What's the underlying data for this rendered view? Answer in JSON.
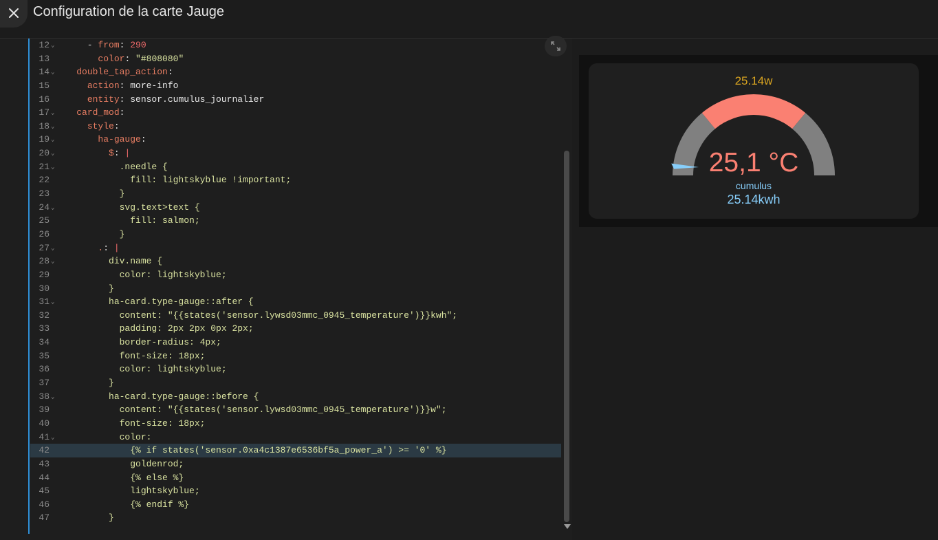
{
  "header": {
    "title": "Configuration de la carte Jauge"
  },
  "editor": {
    "lines": [
      {
        "num": "12",
        "fold": true,
        "segs": [
          {
            "t": "      - ",
            "c": "t"
          },
          {
            "t": "from",
            "c": "k"
          },
          {
            "t": ": ",
            "c": "t"
          },
          {
            "t": "290",
            "c": "n"
          }
        ]
      },
      {
        "num": "13",
        "fold": false,
        "segs": [
          {
            "t": "        ",
            "c": "t"
          },
          {
            "t": "color",
            "c": "k"
          },
          {
            "t": ": ",
            "c": "t"
          },
          {
            "t": "\"#808080\"",
            "c": "s"
          }
        ]
      },
      {
        "num": "14",
        "fold": true,
        "segs": [
          {
            "t": "    ",
            "c": "t"
          },
          {
            "t": "double_tap_action",
            "c": "k"
          },
          {
            "t": ":",
            "c": "t"
          }
        ]
      },
      {
        "num": "15",
        "fold": false,
        "segs": [
          {
            "t": "      ",
            "c": "t"
          },
          {
            "t": "action",
            "c": "k"
          },
          {
            "t": ": more-info",
            "c": "t"
          }
        ]
      },
      {
        "num": "16",
        "fold": false,
        "segs": [
          {
            "t": "      ",
            "c": "t"
          },
          {
            "t": "entity",
            "c": "k"
          },
          {
            "t": ": sensor.cumulus_journalier",
            "c": "t"
          }
        ]
      },
      {
        "num": "17",
        "fold": true,
        "segs": [
          {
            "t": "    ",
            "c": "t"
          },
          {
            "t": "card_mod",
            "c": "k"
          },
          {
            "t": ":",
            "c": "t"
          }
        ]
      },
      {
        "num": "18",
        "fold": true,
        "segs": [
          {
            "t": "      ",
            "c": "t"
          },
          {
            "t": "style",
            "c": "k"
          },
          {
            "t": ":",
            "c": "t"
          }
        ]
      },
      {
        "num": "19",
        "fold": true,
        "segs": [
          {
            "t": "        ",
            "c": "t"
          },
          {
            "t": "ha-gauge",
            "c": "k"
          },
          {
            "t": ":",
            "c": "t"
          }
        ]
      },
      {
        "num": "20",
        "fold": true,
        "segs": [
          {
            "t": "          ",
            "c": "t"
          },
          {
            "t": "$",
            "c": "k"
          },
          {
            "t": ": ",
            "c": "t"
          },
          {
            "t": "|",
            "c": "n"
          }
        ]
      },
      {
        "num": "21",
        "fold": true,
        "segs": [
          {
            "t": "            .needle {",
            "c": "s"
          }
        ]
      },
      {
        "num": "22",
        "fold": false,
        "segs": [
          {
            "t": "              fill: lightskyblue !important;",
            "c": "s"
          }
        ]
      },
      {
        "num": "23",
        "fold": false,
        "segs": [
          {
            "t": "            }",
            "c": "s"
          }
        ]
      },
      {
        "num": "24",
        "fold": true,
        "segs": [
          {
            "t": "            svg.text>text {",
            "c": "s"
          }
        ]
      },
      {
        "num": "25",
        "fold": false,
        "segs": [
          {
            "t": "              fill: salmon;",
            "c": "s"
          }
        ]
      },
      {
        "num": "26",
        "fold": false,
        "segs": [
          {
            "t": "            }",
            "c": "s"
          }
        ]
      },
      {
        "num": "27",
        "fold": true,
        "segs": [
          {
            "t": "        ",
            "c": "t"
          },
          {
            "t": ".",
            "c": "k"
          },
          {
            "t": ": ",
            "c": "t"
          },
          {
            "t": "|",
            "c": "n"
          }
        ]
      },
      {
        "num": "28",
        "fold": true,
        "segs": [
          {
            "t": "          div.name {",
            "c": "s"
          }
        ]
      },
      {
        "num": "29",
        "fold": false,
        "segs": [
          {
            "t": "            color: lightskyblue;",
            "c": "s"
          }
        ]
      },
      {
        "num": "30",
        "fold": false,
        "segs": [
          {
            "t": "          }",
            "c": "s"
          }
        ]
      },
      {
        "num": "31",
        "fold": true,
        "segs": [
          {
            "t": "          ha-card.type-gauge::after {",
            "c": "s"
          }
        ]
      },
      {
        "num": "32",
        "fold": false,
        "segs": [
          {
            "t": "            content: \"{{states('sensor.lywsd03mmc_0945_temperature')}}kwh\";",
            "c": "s"
          }
        ]
      },
      {
        "num": "33",
        "fold": false,
        "segs": [
          {
            "t": "            padding: 2px 2px 0px 2px;",
            "c": "s"
          }
        ]
      },
      {
        "num": "34",
        "fold": false,
        "segs": [
          {
            "t": "            border-radius: 4px;",
            "c": "s"
          }
        ]
      },
      {
        "num": "35",
        "fold": false,
        "segs": [
          {
            "t": "            font-size: 18px;",
            "c": "s"
          }
        ]
      },
      {
        "num": "36",
        "fold": false,
        "segs": [
          {
            "t": "            color: lightskyblue;",
            "c": "s"
          }
        ]
      },
      {
        "num": "37",
        "fold": false,
        "segs": [
          {
            "t": "          }",
            "c": "s"
          }
        ]
      },
      {
        "num": "38",
        "fold": true,
        "segs": [
          {
            "t": "          ha-card.type-gauge::before {",
            "c": "s"
          }
        ]
      },
      {
        "num": "39",
        "fold": false,
        "segs": [
          {
            "t": "            content: \"{{states('sensor.lywsd03mmc_0945_temperature')}}w\";",
            "c": "s"
          }
        ]
      },
      {
        "num": "40",
        "fold": false,
        "segs": [
          {
            "t": "            font-size: 18px;",
            "c": "s"
          }
        ]
      },
      {
        "num": "41",
        "fold": true,
        "segs": [
          {
            "t": "            color:",
            "c": "s"
          }
        ]
      },
      {
        "num": "42",
        "fold": false,
        "hl": true,
        "segs": [
          {
            "t": "              {% if states('sensor.0xa4c1387e6536bf5a_power_a') >= '0' %}",
            "c": "s"
          }
        ]
      },
      {
        "num": "43",
        "fold": false,
        "segs": [
          {
            "t": "              goldenrod;",
            "c": "s"
          }
        ]
      },
      {
        "num": "44",
        "fold": false,
        "segs": [
          {
            "t": "              {% else %}",
            "c": "s"
          }
        ]
      },
      {
        "num": "45",
        "fold": false,
        "segs": [
          {
            "t": "              lightskyblue;",
            "c": "s"
          }
        ]
      },
      {
        "num": "46",
        "fold": false,
        "segs": [
          {
            "t": "              {% endif %}",
            "c": "s"
          }
        ]
      },
      {
        "num": "47",
        "fold": false,
        "segs": [
          {
            "t": "          }",
            "c": "s"
          }
        ]
      }
    ]
  },
  "preview": {
    "before_text": "25.14w",
    "before_color": "#daa520",
    "gauge_value": "25,1 °C",
    "name": "cumulus",
    "after_text": "25.14kwh",
    "gauge": {
      "min": 0,
      "max": 100,
      "value": 25.1,
      "severity_colors": {
        "normal": "#808080",
        "warning": "#fa8072"
      }
    },
    "needle_color": "#87cefa",
    "value_color": "#fa8072",
    "name_color": "#87cefa"
  }
}
